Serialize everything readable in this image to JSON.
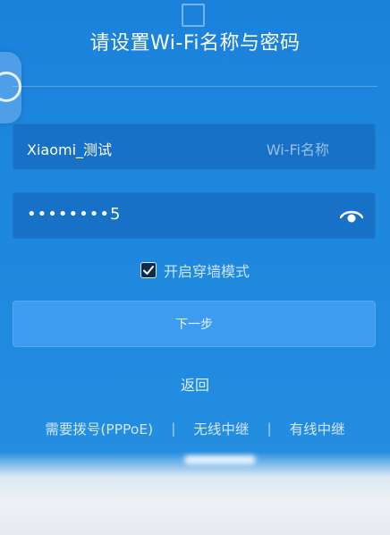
{
  "title": "请设置Wi-Fi名称与密码",
  "ssid_field": {
    "value": "Xiaomi_测试",
    "placeholder": "Wi-Fi名称"
  },
  "password_field": {
    "value": "••••••••5",
    "icon": "eye-icon"
  },
  "wall_mode": {
    "label": "开启穿墙模式",
    "checked": true
  },
  "next_button": {
    "label": "下一步"
  },
  "back_link": {
    "label": "返回"
  },
  "bottom_links": [
    {
      "label": "需要拨号(PPPoE)"
    },
    {
      "label": "无线中继"
    },
    {
      "label": "有线中继"
    }
  ],
  "separator": "|",
  "colors": {
    "background": "#1e86dc",
    "field_bg": "#1671c7",
    "button_bg": "#3d9cf0"
  }
}
